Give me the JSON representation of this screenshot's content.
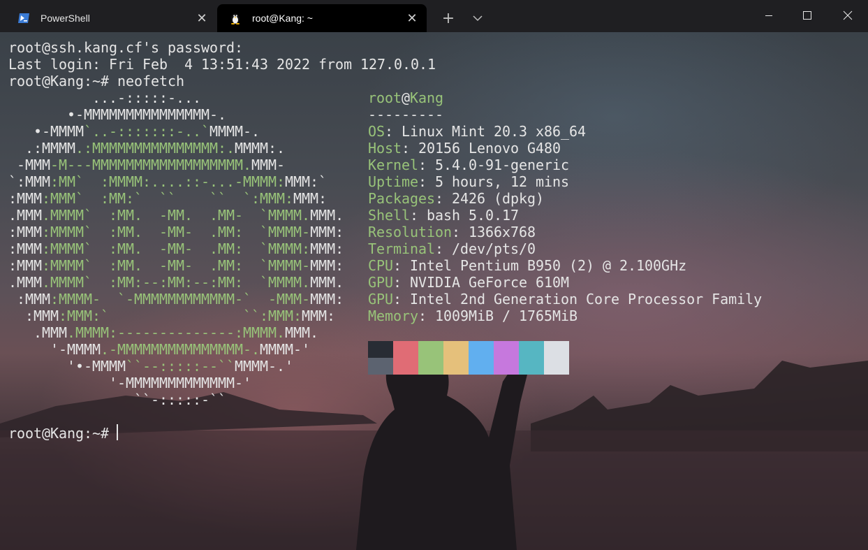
{
  "tabs": [
    {
      "label": "PowerShell",
      "icon": "powershell-icon",
      "active": false
    },
    {
      "label": "root@Kang: ~",
      "icon": "linux-penguin-icon",
      "active": true
    }
  ],
  "colors": {
    "titlebar": "#1f1f22",
    "active_tab": "#000000",
    "text": "#e5e5e5",
    "green": "#98c379"
  },
  "terminal": {
    "pre_lines": [
      "root@ssh.kang.cf's password:",
      "Last login: Fri Feb  4 13:51:43 2022 from 127.0.0.1",
      "root@Kang:~# neofetch"
    ],
    "logo": [
      [
        [
          "w",
          "          ...-:::::-..."
        ]
      ],
      [
        [
          "w",
          "       •-MMMMMMMMMMMMMMM-."
        ]
      ],
      [
        [
          "w",
          "   •-MMMM"
        ],
        [
          "g",
          "`..-:::::::-..`"
        ],
        [
          "w",
          "MMMM-."
        ]
      ],
      [
        [
          "w",
          "  .:MMMM"
        ],
        [
          "g",
          ".:MMMMMMMMMMMMMMM:."
        ],
        [
          "w",
          "MMMM:."
        ]
      ],
      [
        [
          "w",
          " -MMM"
        ],
        [
          "g",
          "-M---MMMMMMMMMMMMMMMMMM."
        ],
        [
          "w",
          "MMM-"
        ]
      ],
      [
        [
          "w",
          "`:MMM"
        ],
        [
          "g",
          ":MM`  :MMMM:....::-...-MMMM:"
        ],
        [
          "w",
          "MMM:`"
        ]
      ],
      [
        [
          "w",
          ":MMM"
        ],
        [
          "g",
          ":MMM`  :MM:`  ``    ``  `:MMM:"
        ],
        [
          "w",
          "MMM:"
        ]
      ],
      [
        [
          "w",
          ".MMM"
        ],
        [
          "g",
          ".MMMM`  :MM.  -MM.  .MM-  `MMMM."
        ],
        [
          "w",
          "MMM."
        ]
      ],
      [
        [
          "w",
          ":MMM"
        ],
        [
          "g",
          ":MMMM`  :MM.  -MM-  .MM:  `MMMM-"
        ],
        [
          "w",
          "MMM:"
        ]
      ],
      [
        [
          "w",
          ":MMM"
        ],
        [
          "g",
          ":MMMM`  :MM.  -MM-  .MM:  `MMMM:"
        ],
        [
          "w",
          "MMM:"
        ]
      ],
      [
        [
          "w",
          ":MMM"
        ],
        [
          "g",
          ":MMMM`  :MM.  -MM-  .MM:  `MMMM-"
        ],
        [
          "w",
          "MMM:"
        ]
      ],
      [
        [
          "w",
          ".MMM"
        ],
        [
          "g",
          ".MMMM`  :MM:--:MM:--:MM:  `MMMM."
        ],
        [
          "w",
          "MMM."
        ]
      ],
      [
        [
          "w",
          " :MMM"
        ],
        [
          "g",
          ":MMMM-  `-MMMMMMMMMMMM-`  -MMM-"
        ],
        [
          "w",
          "MMM:"
        ]
      ],
      [
        [
          "w",
          "  :MMM"
        ],
        [
          "g",
          ":MMM:`                ``:MMM:"
        ],
        [
          "w",
          "MMM:"
        ]
      ],
      [
        [
          "w",
          "   .MMM"
        ],
        [
          "g",
          ".MMMM:--------------:MMMM."
        ],
        [
          "w",
          "MMM."
        ]
      ],
      [
        [
          "w",
          "     '-MMMM"
        ],
        [
          "g",
          ".-MMMMMMMMMMMMMMM-."
        ],
        [
          "w",
          "MMMM-'"
        ]
      ],
      [
        [
          "w",
          "       '•-MMMM"
        ],
        [
          "g",
          "``--:::::--``"
        ],
        [
          "w",
          "MMMM-.'"
        ]
      ],
      [
        [
          "w",
          "            '-MMMMMMMMMMMMM-'"
        ]
      ],
      [
        [
          "w",
          "               ``-:::::-``"
        ]
      ]
    ],
    "info_header": {
      "user": "root",
      "at": "@",
      "host": "Kang",
      "underline": "---------"
    },
    "info": [
      {
        "key": "OS",
        "value": "Linux Mint 20.3 x86_64"
      },
      {
        "key": "Host",
        "value": "20156 Lenovo G480"
      },
      {
        "key": "Kernel",
        "value": "5.4.0-91-generic"
      },
      {
        "key": "Uptime",
        "value": "5 hours, 12 mins"
      },
      {
        "key": "Packages",
        "value": "2426 (dpkg)"
      },
      {
        "key": "Shell",
        "value": "bash 5.0.17"
      },
      {
        "key": "Resolution",
        "value": "1366x768"
      },
      {
        "key": "Terminal",
        "value": "/dev/pts/0"
      },
      {
        "key": "CPU",
        "value": "Intel Pentium B950 (2) @ 2.100GHz"
      },
      {
        "key": "GPU",
        "value": "NVIDIA GeForce 610M"
      },
      {
        "key": "GPU",
        "value": "Intel 2nd Generation Core Processor Family"
      },
      {
        "key": "Memory",
        "value": "1009MiB / 1765MiB"
      }
    ],
    "palette_dark": [
      "#282c34",
      "#e06c75",
      "#98c379",
      "#e5c07b",
      "#61afef",
      "#c678dd",
      "#56b6c2",
      "#dcdfe4"
    ],
    "palette_light": [
      "#5c6370",
      "#e06c75",
      "#98c379",
      "#e5c07b",
      "#61afef",
      "#c678dd",
      "#56b6c2",
      "#dcdfe4"
    ],
    "prompt": "root@Kang:~# "
  }
}
